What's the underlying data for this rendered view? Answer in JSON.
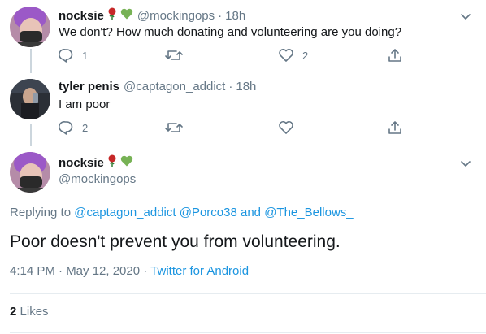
{
  "tweets": [
    {
      "name": "nocksie",
      "emojis": [
        "rose",
        "green-heart"
      ],
      "handle": "@mockingops",
      "time": "18h",
      "text": "We don't? How much donating and volunteering are you doing?",
      "reply_count": "1",
      "like_count": "2"
    },
    {
      "name": "tyler penis",
      "handle": "@captagon_addict",
      "time": "18h",
      "text": "I am poor",
      "reply_count": "2"
    }
  ],
  "main_tweet": {
    "name": "nocksie",
    "emojis": [
      "rose",
      "green-heart"
    ],
    "handle": "@mockingops",
    "replying_prefix": "Replying to",
    "mention_1": "@captagon_addict",
    "mention_2": "@Porco38",
    "and_word": "and",
    "mention_3": "@The_Bellows_",
    "text": "Poor doesn't prevent you from volunteering.",
    "timestamp": "4:14 PM · May 12, 2020",
    "separator": "·",
    "source": "Twitter for Android",
    "likes_count": "2",
    "likes_label": "Likes"
  },
  "colors": {
    "text": "#14171a",
    "secondary": "#657786",
    "link": "#1b95e0",
    "line": "#ccd6dd"
  },
  "icons": [
    "reply-icon",
    "retweet-icon",
    "like-icon",
    "share-icon",
    "chevron-down-icon",
    "rose-emoji",
    "green-heart-emoji"
  ]
}
